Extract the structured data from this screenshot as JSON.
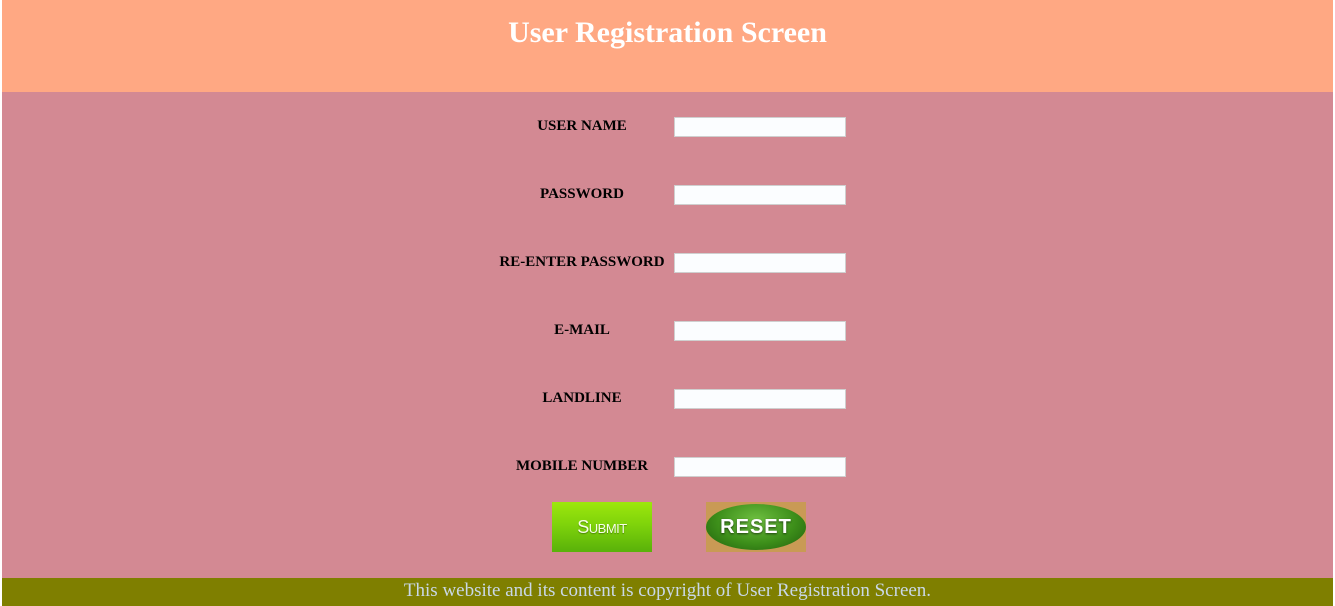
{
  "header": {
    "title": "User Registration Screen"
  },
  "form": {
    "fields": [
      {
        "label": "USER NAME",
        "value": "",
        "placeholder": ""
      },
      {
        "label": "PASSWORD",
        "value": "",
        "placeholder": ""
      },
      {
        "label": "RE-ENTER PASSWORD",
        "value": "",
        "placeholder": ""
      },
      {
        "label": "E-MAIL",
        "value": "",
        "placeholder": ""
      },
      {
        "label": "LANDLINE",
        "value": "",
        "placeholder": ""
      },
      {
        "label": "MOBILE NUMBER",
        "value": "",
        "placeholder": ""
      }
    ],
    "submit_label": "Submit",
    "reset_label": "RESET"
  },
  "footer": {
    "text": "This website and its content is copyright of User Registration Screen."
  },
  "colors": {
    "header_bg": "#ffa883",
    "main_bg": "#d38993",
    "footer_bg": "#7f7f00",
    "title_text": "#ffffff",
    "footer_text": "#c9d8e8",
    "submit_green": "#7fd30b",
    "reset_green": "#3d8f1a"
  }
}
